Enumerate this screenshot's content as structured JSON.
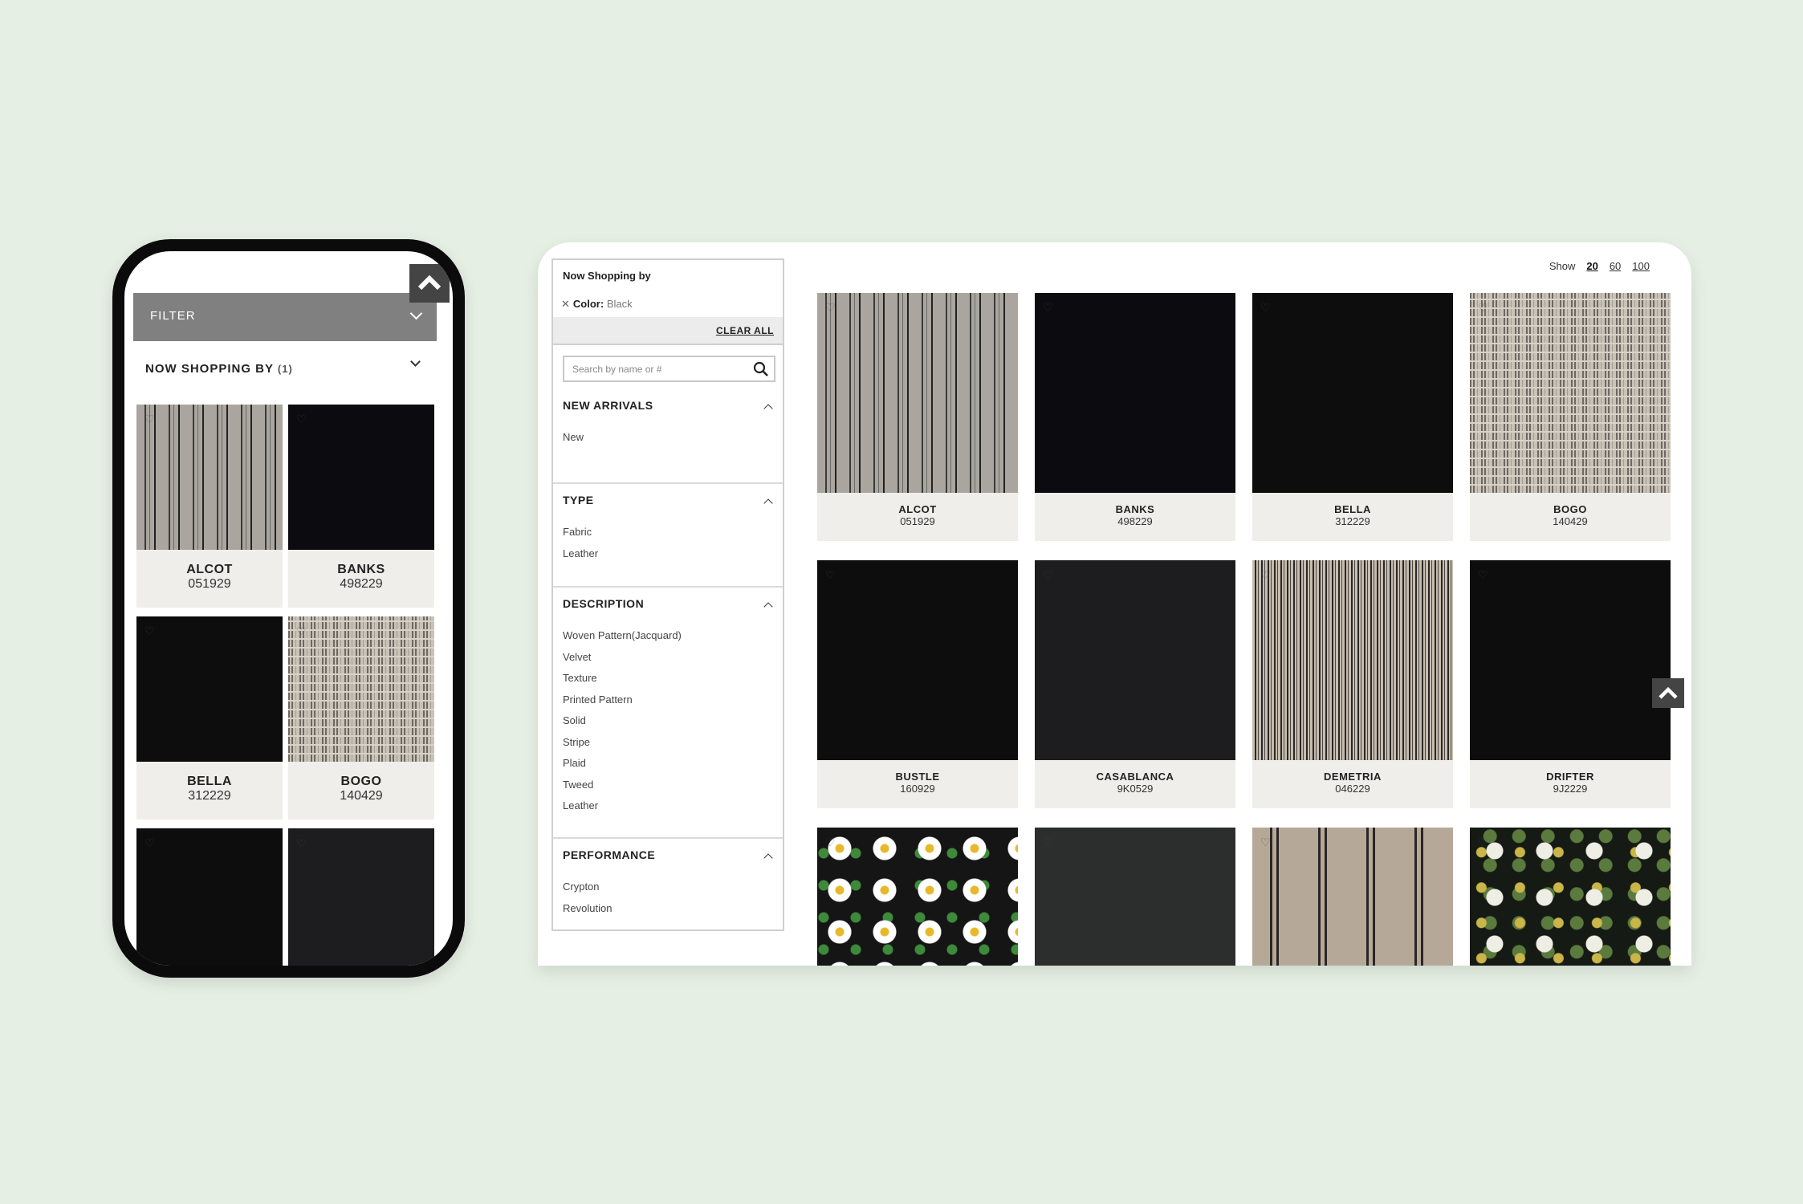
{
  "colors": {
    "background": "#e6efe4",
    "filter_bar": "#808080",
    "label_bg": "#f0eeea",
    "back_to_top": "#444444"
  },
  "mobile": {
    "filter_label": "FILTER",
    "now_shopping_label": "NOW SHOPPING BY",
    "now_shopping_count": "(1)",
    "products": [
      {
        "name": "ALCOT",
        "code": "051929",
        "swatch": "stripe-gray"
      },
      {
        "name": "BANKS",
        "code": "498229",
        "swatch": "black"
      },
      {
        "name": "BELLA",
        "code": "312229",
        "swatch": "black2"
      },
      {
        "name": "BOGO",
        "code": "140429",
        "swatch": "dash"
      },
      {
        "name": "",
        "code": "",
        "swatch": "black2"
      },
      {
        "name": "",
        "code": "",
        "swatch": "charcoal"
      }
    ]
  },
  "desktop": {
    "sidebar": {
      "now_shopping_title": "Now Shopping by",
      "active_filter_label": "Color:",
      "active_filter_value": "Black",
      "clear_all": "CLEAR ALL",
      "search_placeholder": "Search by name or #",
      "sections": [
        {
          "title": "NEW ARRIVALS",
          "options": [
            "New"
          ]
        },
        {
          "title": "TYPE",
          "options": [
            "Fabric",
            "Leather"
          ]
        },
        {
          "title": "DESCRIPTION",
          "options": [
            "Woven Pattern(Jacquard)",
            "Velvet",
            "Texture",
            "Printed Pattern",
            "Solid",
            "Stripe",
            "Plaid",
            "Tweed",
            "Leather"
          ]
        },
        {
          "title": "PERFORMANCE",
          "options": [
            "Crypton",
            "Revolution"
          ]
        }
      ]
    },
    "show": {
      "label": "Show",
      "options": [
        "20",
        "60",
        "100"
      ],
      "selected": "20"
    },
    "products": [
      {
        "name": "ALCOT",
        "code": "051929",
        "swatch": "stripe-gray"
      },
      {
        "name": "BANKS",
        "code": "498229",
        "swatch": "black"
      },
      {
        "name": "BELLA",
        "code": "312229",
        "swatch": "black2"
      },
      {
        "name": "BOGO",
        "code": "140429",
        "swatch": "dash"
      },
      {
        "name": "BUSTLE",
        "code": "160929",
        "swatch": "black2"
      },
      {
        "name": "CASABLANCA",
        "code": "9K0529",
        "swatch": "charcoal"
      },
      {
        "name": "DEMETRIA",
        "code": "046229",
        "swatch": "pinstripe"
      },
      {
        "name": "DRIFTER",
        "code": "9J2229",
        "swatch": "black2"
      },
      {
        "name": "",
        "code": "",
        "swatch": "daisy"
      },
      {
        "name": "",
        "code": "",
        "swatch": "slate"
      },
      {
        "name": "",
        "code": "",
        "swatch": "wide-stripe"
      },
      {
        "name": "",
        "code": "",
        "swatch": "floral"
      }
    ]
  }
}
